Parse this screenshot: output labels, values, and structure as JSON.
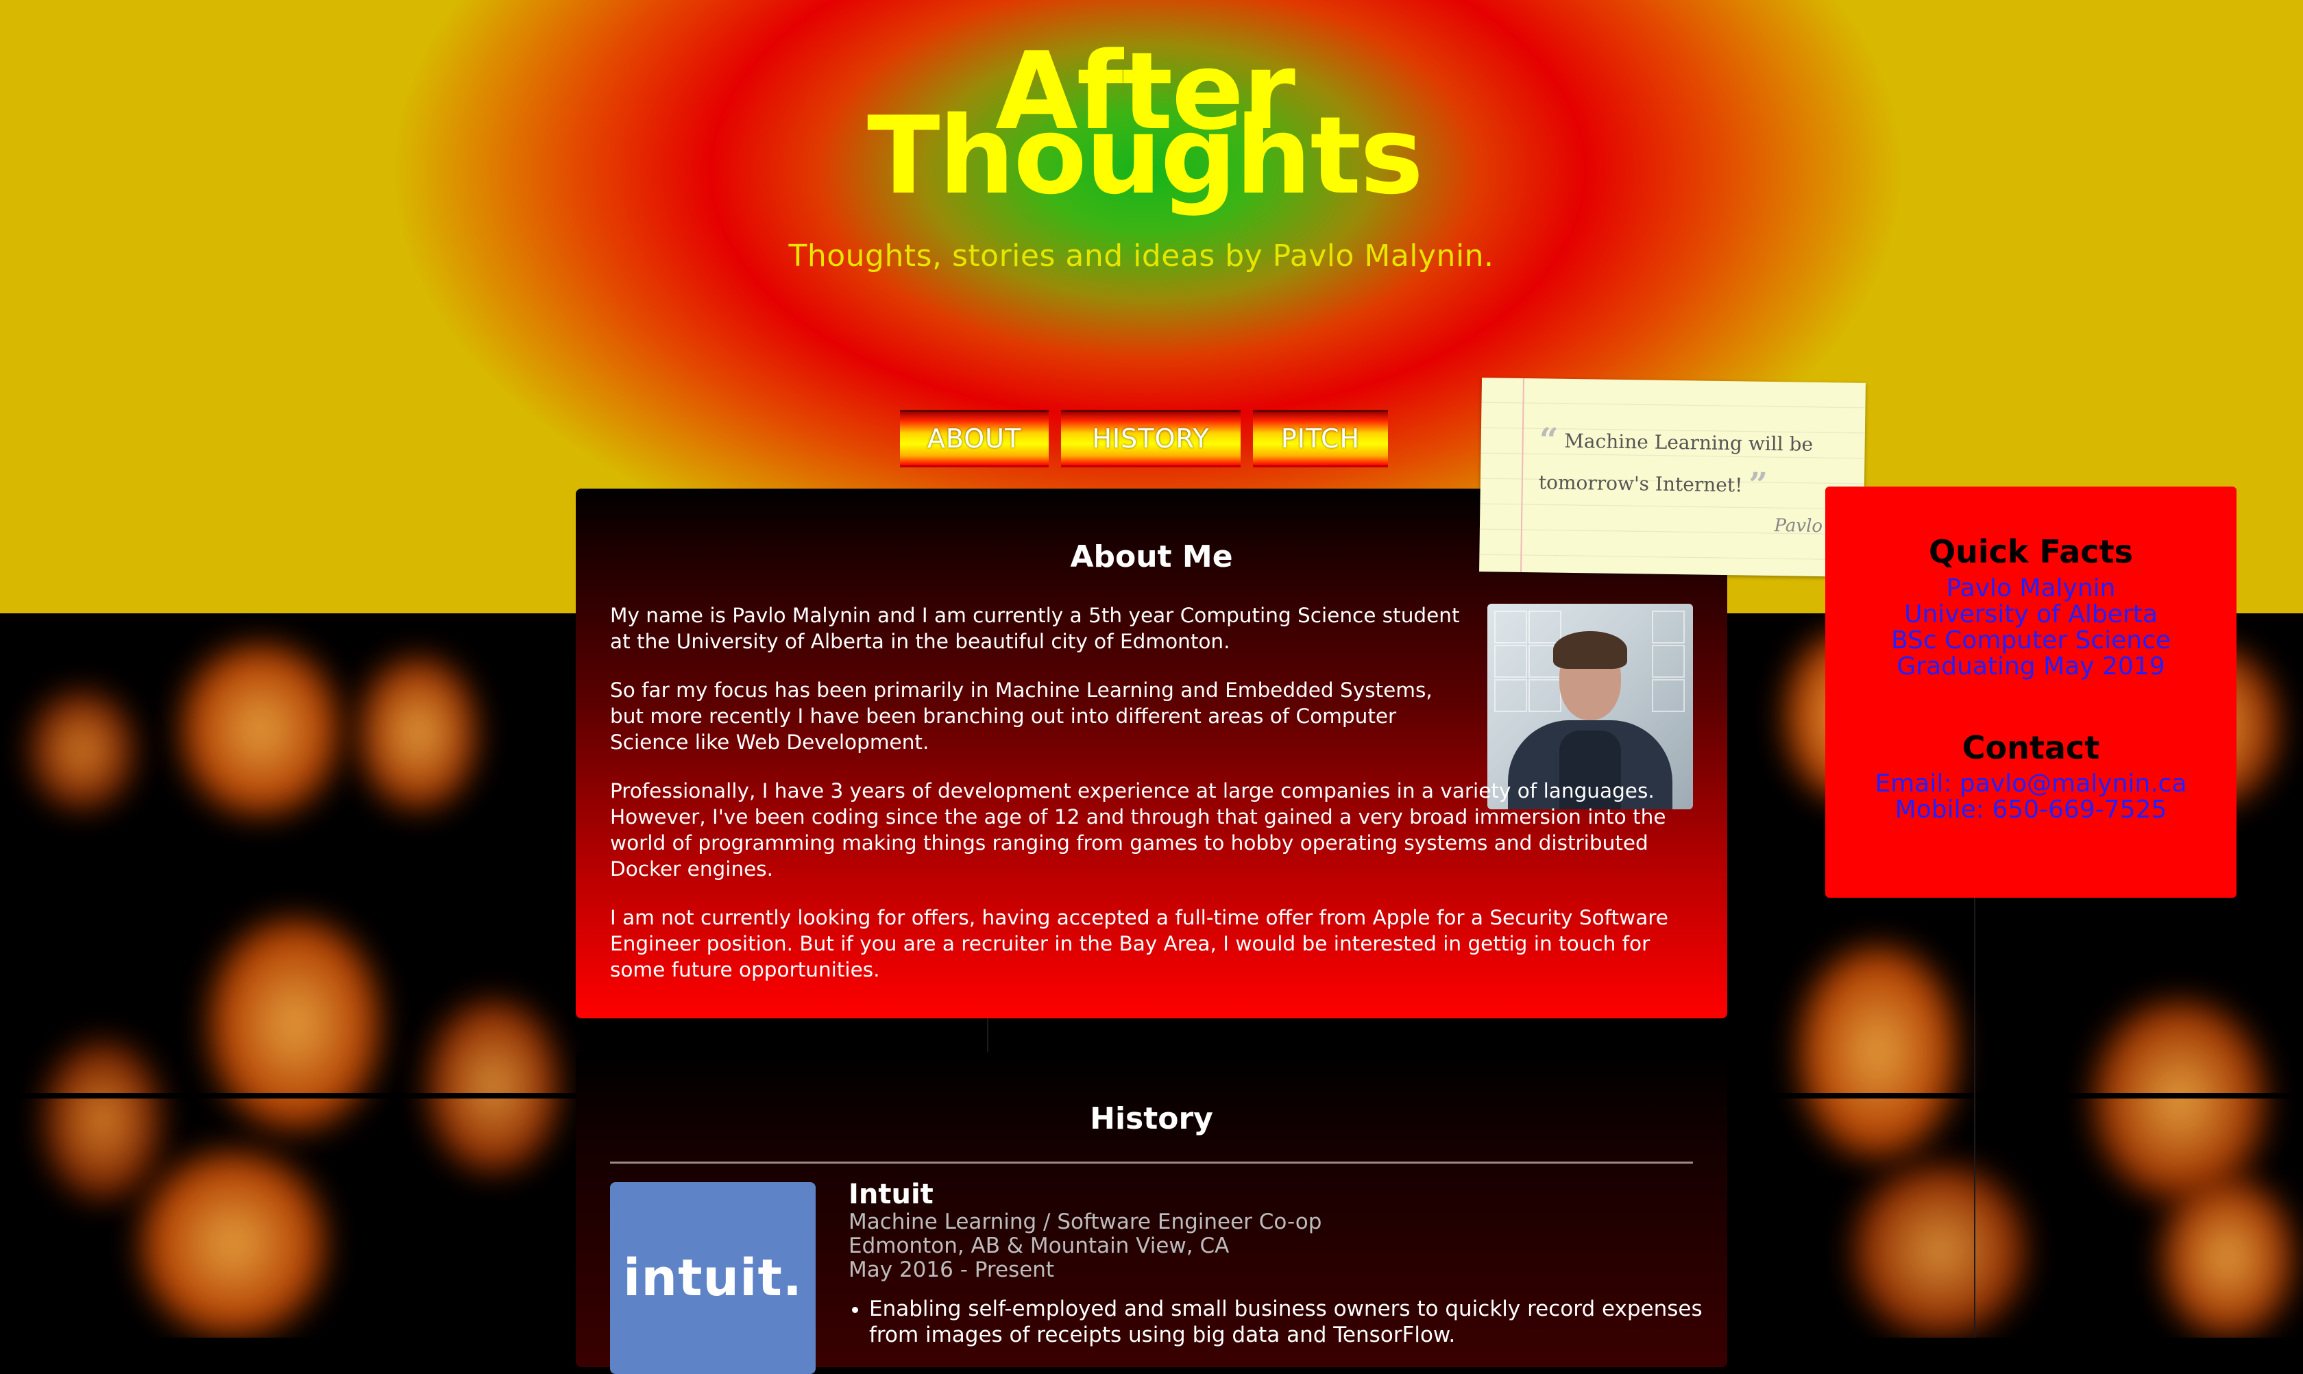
{
  "site": {
    "title_line1": "After",
    "title_line2": "Thoughts",
    "tagline": "Thoughts, stories and ideas by Pavlo Malynin."
  },
  "nav": {
    "about": "ABOUT",
    "history": "HISTORY",
    "pitch": "PITCH"
  },
  "about": {
    "heading": "About Me",
    "paragraphs": [
      "My name is Pavlo Malynin and I am currently a 5th year Computing Science student at the University of Alberta in the beautiful city of Edmonton.",
      "So far my focus has been primarily in Machine Learning and Embedded Systems, but more recently I have been branching out into different areas of Computer Science like Web Development.",
      "Professionally, I have 3 years of development experience at large companies in a variety of languages. However, I've been coding since the age of 12 and through that gained a very broad immersion into the world of programming making things ranging from games to hobby operating systems and distributed Docker engines.",
      "I am not currently looking for offers, having accepted a full-time offer from Apple for a Security Software Engineer position. But if you are a recruiter in the Bay Area, I would be interested in gettig in touch for some future opportunities."
    ]
  },
  "quote": {
    "text": "Machine Learning will be tomorrow's Internet!",
    "author": "Pavlo"
  },
  "quick_facts": {
    "heading": "Quick Facts",
    "items": [
      "Pavlo Malynin",
      "University of Alberta",
      "BSc Computer Science",
      "Graduating May 2019"
    ]
  },
  "contact": {
    "heading": "Contact",
    "email": "Email: pavlo@malynin.ca",
    "mobile": "Mobile: 650-669-7525"
  },
  "history": {
    "heading": "History",
    "jobs": [
      {
        "logo_text": "intuit.",
        "company": "Intuit",
        "role": "Machine Learning / Software Engineer Co-op",
        "location": "Edmonton, AB & Mountain View, CA",
        "dates": "May 2016 - Present",
        "bullets": [
          "Enabling self-employed and small business owners to quickly record expenses from images of receipts using big data and TensorFlow."
        ]
      }
    ]
  },
  "colors": {
    "title_yellow": "#ffff00",
    "facts_red": "#ff0000",
    "link_blue": "#2020ff",
    "intuit_blue": "#5f83c7"
  }
}
